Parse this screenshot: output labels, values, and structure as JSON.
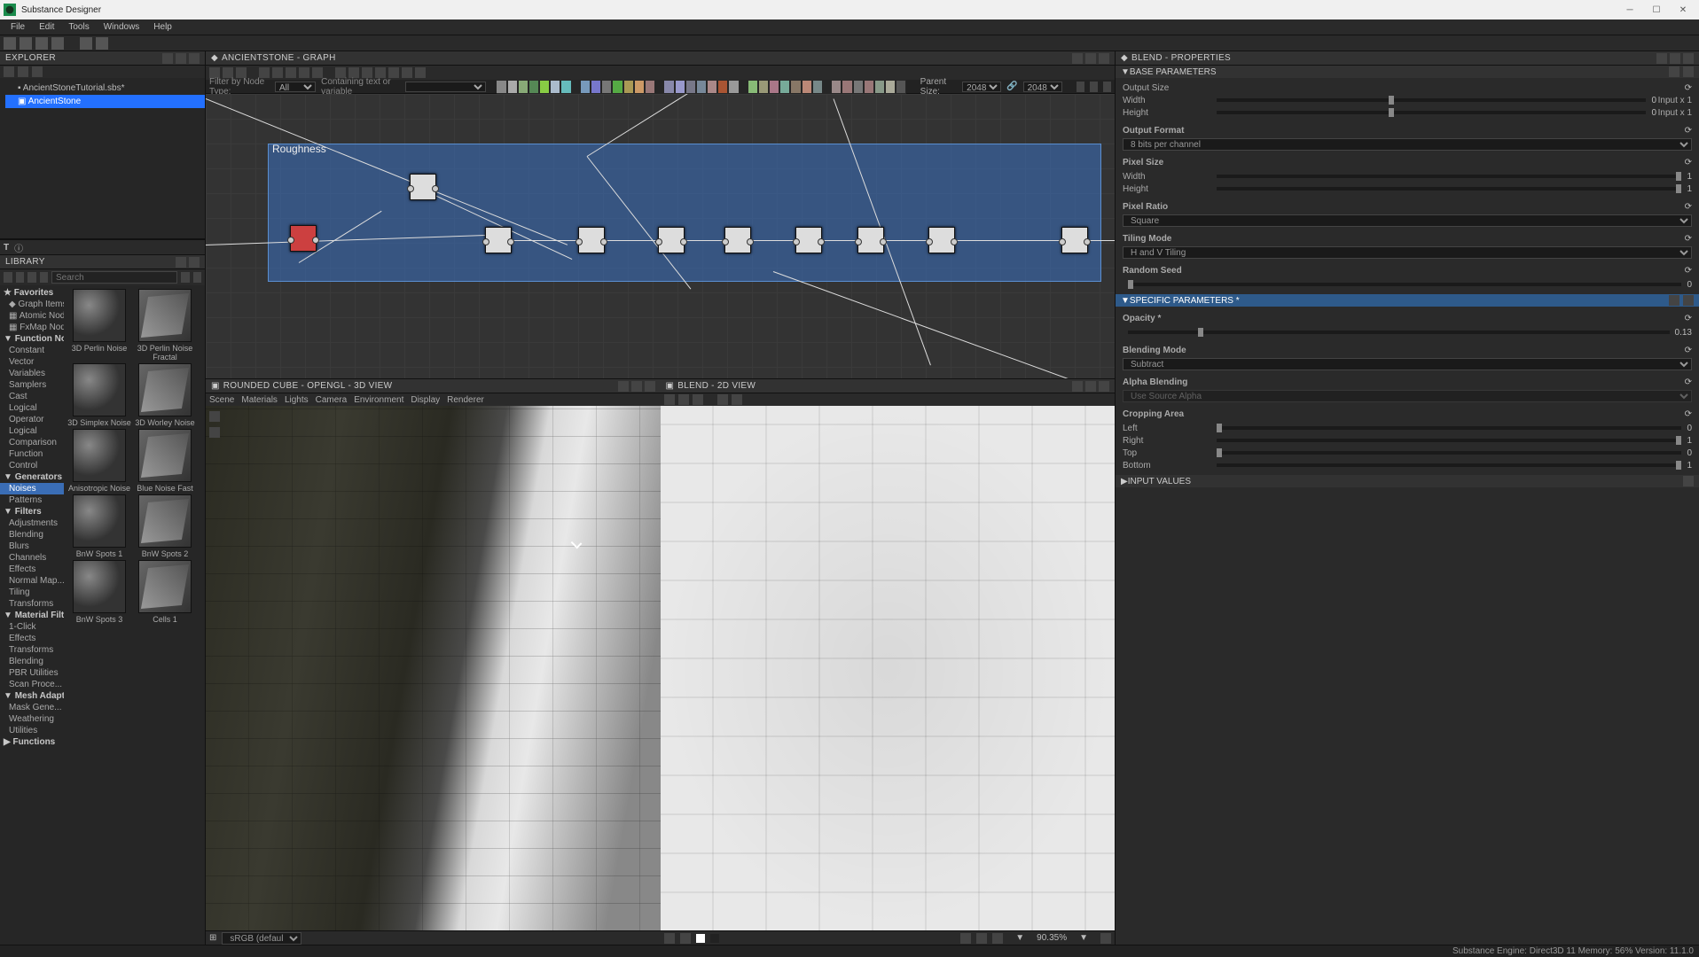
{
  "app": {
    "title": "Substance Designer"
  },
  "menu": [
    "File",
    "Edit",
    "Tools",
    "Windows",
    "Help"
  ],
  "explorer": {
    "title": "EXPLORER",
    "file": "AncientStoneTutorial.sbs*",
    "graph": "AncientStone"
  },
  "library": {
    "title": "LIBRARY",
    "search_placeholder": "Search",
    "tree": {
      "favorites": "Favorites",
      "graph": "Graph Items",
      "atomic": "Atomic Nodes",
      "fxmap": "FxMap Nodes",
      "function": "Function Nodes",
      "func_children": [
        "Constant",
        "Vector",
        "Variables",
        "Samplers",
        "Cast",
        "Logical",
        "Operator",
        "Logical",
        "Comparison",
        "Function",
        "Control"
      ],
      "generators": "Generators",
      "noises": "Noises",
      "patterns": "Patterns",
      "filters": "Filters",
      "filt_children": [
        "Adjustments",
        "Blending",
        "Blurs",
        "Channels",
        "Effects",
        "Normal Map...",
        "Tiling",
        "Transforms"
      ],
      "matfilters": "Material Filters",
      "matf_children": [
        "1-Click",
        "Effects",
        "Transforms",
        "Blending",
        "PBR Utilities",
        "Scan Proce..."
      ],
      "mesh": "Mesh Adaptive",
      "mesh_children": [
        "Mask Gene...",
        "Weathering",
        "Utilities"
      ],
      "functions": "Functions"
    },
    "thumbs": [
      {
        "label": "3D Perlin Noise"
      },
      {
        "label": "3D Perlin Noise Fractal"
      },
      {
        "label": "3D Simplex Noise"
      },
      {
        "label": "3D Worley Noise"
      },
      {
        "label": "Anisotropic Noise"
      },
      {
        "label": "Blue Noise Fast"
      },
      {
        "label": "BnW Spots 1"
      },
      {
        "label": "BnW Spots 2"
      },
      {
        "label": "BnW Spots 3"
      },
      {
        "label": "Cells 1"
      }
    ]
  },
  "graph": {
    "title": "AncientStone - GRAPH",
    "filter_label": "Filter by Node Type:",
    "filter_all": "All",
    "filter_containing": "Containing text or variable",
    "parent_size_label": "Parent Size:",
    "parent_size_w": "2048",
    "parent_size_h": "2048",
    "frame_label": "Roughness"
  },
  "view3d": {
    "title": "Rounded Cube - OpenGL - 3D VIEW",
    "menu": [
      "Scene",
      "Materials",
      "Lights",
      "Camera",
      "Environment",
      "Display",
      "Renderer"
    ],
    "profile": "sRGB (default)"
  },
  "view2d": {
    "title": "Blend - 2D VIEW",
    "zoom": "90.35%"
  },
  "properties": {
    "title": "Blend - PROPERTIES",
    "base_params": "BASE PARAMETERS",
    "output_size": "Output Size",
    "width": "Width",
    "height": "Height",
    "input_x1": "Input x 1",
    "zero": "0",
    "output_format": "Output Format",
    "format_val": "8 bits per channel",
    "pixel_size": "Pixel Size",
    "w_val": "1",
    "h_val": "1",
    "pixel_ratio": "Pixel Ratio",
    "ratio_val": "Square",
    "tiling": "Tiling Mode",
    "tiling_val": "H and V Tiling",
    "seed": "Random Seed",
    "seed_val": "0",
    "specific": "SPECIFIC PARAMETERS *",
    "opacity": "Opacity *",
    "opacity_val": "0.13",
    "blend_mode": "Blending Mode",
    "blend_val": "Subtract",
    "alpha": "Alpha Blending",
    "alpha_val": "Use Source Alpha",
    "crop": "Cropping Area",
    "left": "Left",
    "right": "Right",
    "top": "Top",
    "bottom": "Bottom",
    "l": "0",
    "r": "1",
    "t": "0",
    "b": "1",
    "input_values": "INPUT VALUES"
  },
  "statusbar": "Substance Engine: Direct3D 11  Memory: 56%    Version: 11.1.0",
  "palette_colors": [
    "#888",
    "#aaa",
    "#8a7",
    "#585",
    "#8c4",
    "#abc",
    "#6bb",
    "#79b",
    "#77c",
    "#777",
    "#5a4",
    "#a95",
    "#c96",
    "#977",
    "#88a",
    "#99c",
    "#778",
    "#789",
    "#a88",
    "#a53",
    "#999",
    "#8b7",
    "#997",
    "#a78",
    "#7a9",
    "#876",
    "#b87",
    "#788",
    "#988",
    "#977",
    "#777",
    "#977",
    "#898",
    "#aa9",
    "#555"
  ]
}
